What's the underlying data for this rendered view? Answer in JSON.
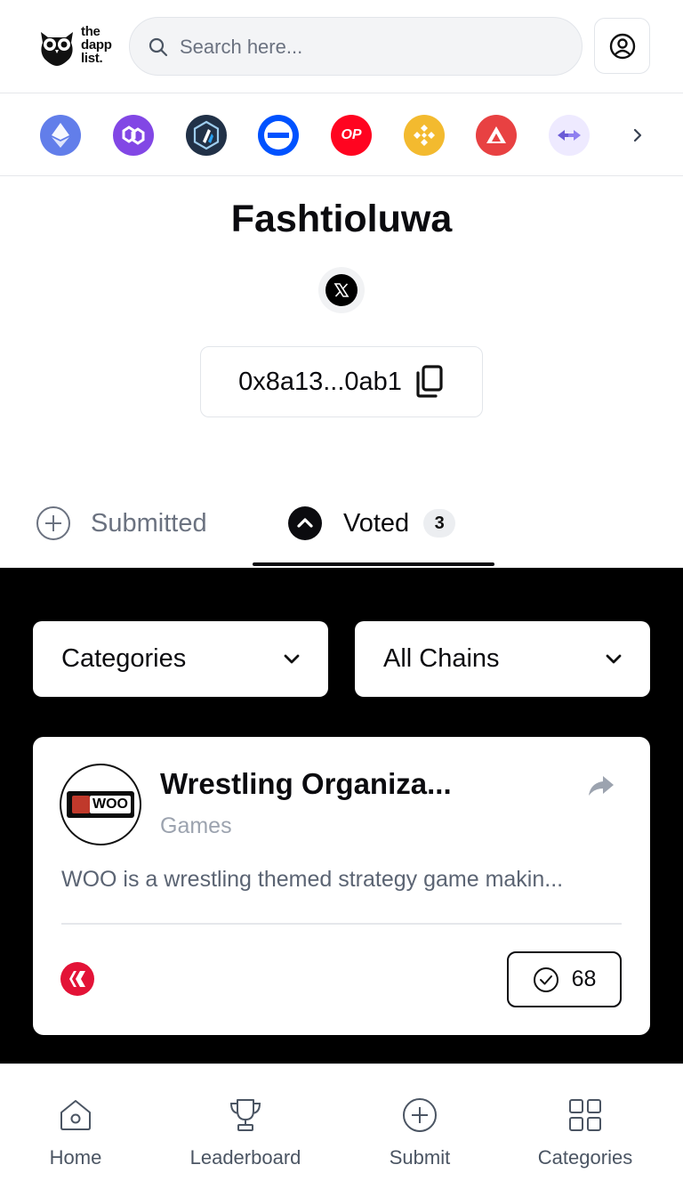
{
  "header": {
    "logo_lines": [
      "the",
      "dapp",
      "list."
    ],
    "search_placeholder": "Search here..."
  },
  "chains": [
    {
      "icon": "ethereum-icon",
      "color": "#627eea"
    },
    {
      "icon": "polygon-icon",
      "color": "#8247e5"
    },
    {
      "icon": "arbitrum-icon",
      "color": "#213147"
    },
    {
      "icon": "base-icon",
      "color": "#0052ff"
    },
    {
      "icon": "optimism-icon",
      "color": "#ff0420",
      "label": "OP"
    },
    {
      "icon": "bnb-icon",
      "color": "#f3ba2f"
    },
    {
      "icon": "avalanche-icon",
      "color": "#e84142"
    },
    {
      "icon": "bridge-icon",
      "color": "#eeeaff"
    }
  ],
  "profile": {
    "name": "Fashtioluwa",
    "address": "0x8a13...0ab1"
  },
  "tabs": {
    "submitted": "Submitted",
    "voted": "Voted",
    "voted_count": "3"
  },
  "filters": {
    "categories": "Categories",
    "chains": "All Chains"
  },
  "card": {
    "logo_text": "WOO",
    "title": "Wrestling Organiza...",
    "category": "Games",
    "description": "WOO is a wrestling themed strategy game makin...",
    "votes": "68"
  },
  "nav": {
    "home": "Home",
    "leaderboard": "Leaderboard",
    "submit": "Submit",
    "categories": "Categories"
  }
}
